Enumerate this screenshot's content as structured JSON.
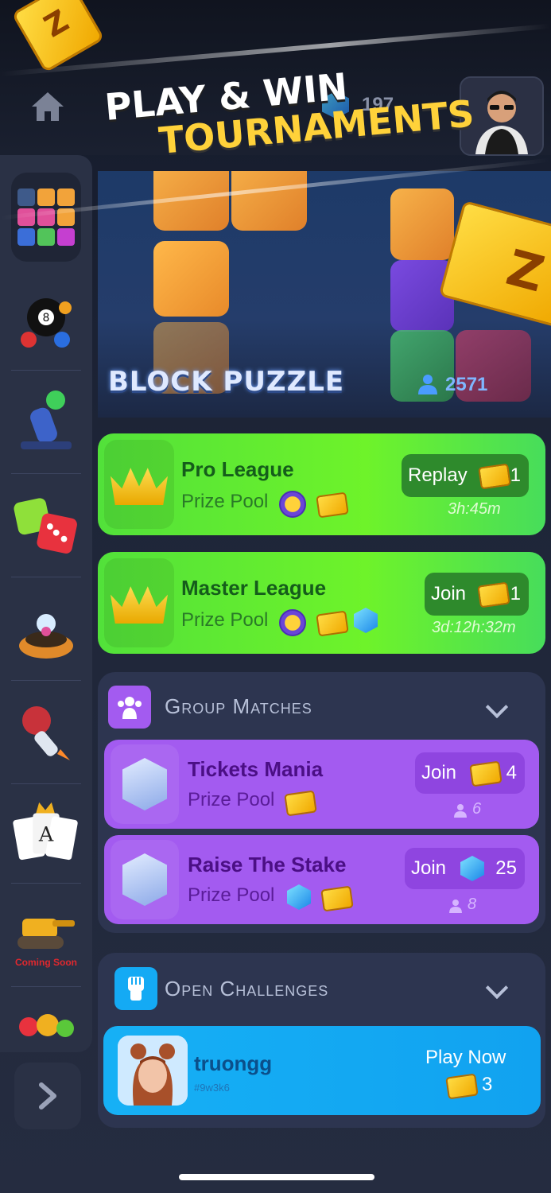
{
  "header": {
    "gem_count": "197",
    "promo_line1": "PLAY & WIN",
    "promo_line2": "TOURNAMENTS"
  },
  "sidebar": {
    "items": [
      {
        "name": "block-puzzle-game",
        "selected": true
      },
      {
        "name": "8-ball-pool-game"
      },
      {
        "name": "cannon-game"
      },
      {
        "name": "dice-game"
      },
      {
        "name": "ball-hole-game"
      },
      {
        "name": "rocket-game"
      },
      {
        "name": "solitaire-game"
      },
      {
        "name": "tank-game",
        "badge": "Coming Soon"
      },
      {
        "name": "fruit-game"
      }
    ]
  },
  "hero": {
    "title": "BLOCK PUZZLE",
    "players": "2571"
  },
  "leagues": [
    {
      "title": "Pro League",
      "prize_label": "Prize Pool",
      "button": "Replay",
      "cost": "1",
      "timer": "3h:45m"
    },
    {
      "title": "Master League",
      "prize_label": "Prize Pool",
      "button": "Join",
      "cost": "1",
      "timer": "3d:12h:32m"
    }
  ],
  "group_matches": {
    "title": "Group Matches",
    "items": [
      {
        "title": "Tickets Mania",
        "prize_label": "Prize Pool",
        "button": "Join",
        "cost": "4",
        "players": "6"
      },
      {
        "title": "Raise The Stake",
        "prize_label": "Prize Pool",
        "button": "Join",
        "cost": "25",
        "players": "8"
      }
    ]
  },
  "open_challenges": {
    "title": "Open Challenges",
    "items": [
      {
        "username": "truongg",
        "user_id": "#9w3k6",
        "button": "Play Now",
        "cost": "3"
      }
    ]
  },
  "colors": {
    "league_green": "#5ee635",
    "group_purple": "#a35bf0",
    "challenge_blue": "#14aaf4",
    "ticket_gold": "#ffd23a"
  }
}
